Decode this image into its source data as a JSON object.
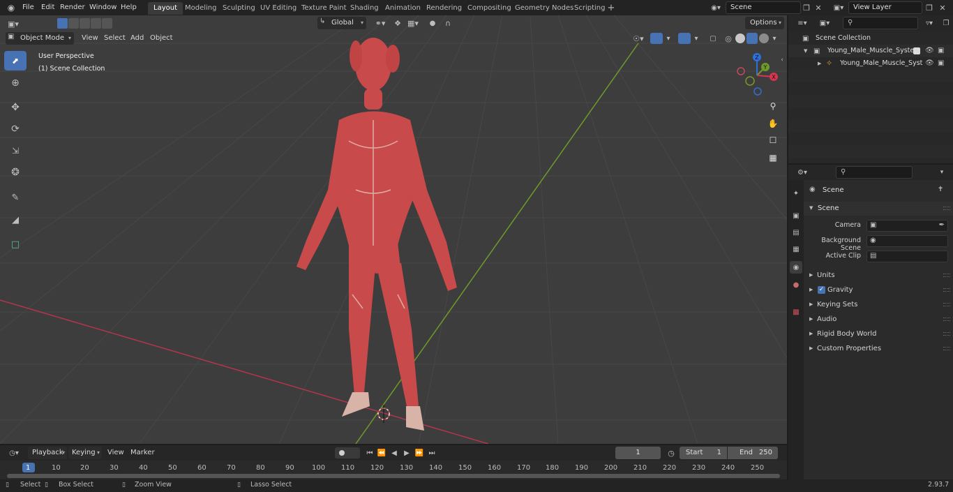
{
  "topbar": {
    "menus": [
      "File",
      "Edit",
      "Render",
      "Window",
      "Help"
    ],
    "workspaces": [
      "Layout",
      "Modeling",
      "Sculpting",
      "UV Editing",
      "Texture Paint",
      "Shading",
      "Animation",
      "Rendering",
      "Compositing",
      "Geometry Nodes",
      "Scripting"
    ],
    "active_workspace": "Layout",
    "scene_name": "Scene",
    "view_layer": "View Layer"
  },
  "viewport_header": {
    "mode": "Object Mode",
    "menus": [
      "View",
      "Select",
      "Add",
      "Object"
    ],
    "transform_orientation": "Global",
    "options_label": "Options"
  },
  "viewport": {
    "overlay_line1": "User Perspective",
    "overlay_line2": "(1) Scene Collection",
    "gizmo_axes": [
      "Z",
      "Y",
      "X"
    ],
    "colors": {
      "background": "#3d3d3d",
      "x_axis": "#b3364a",
      "y_axis": "#6e9a2a",
      "mesh": "#c84a4a"
    }
  },
  "outliner": {
    "root": "Scene Collection",
    "items": [
      "Young_Male_Muscle_System",
      "Young_Male_Muscle_Syst"
    ]
  },
  "properties": {
    "header": "Scene",
    "panel_title": "Scene",
    "fields": [
      {
        "label": "Camera"
      },
      {
        "label": "Background Scene"
      },
      {
        "label": "Active Clip"
      }
    ],
    "sections": [
      "Units",
      "Gravity",
      "Keying Sets",
      "Audio",
      "Rigid Body World",
      "Custom Properties"
    ],
    "gravity_checked": true
  },
  "timeline": {
    "menus": [
      "Playback",
      "Keying",
      "View",
      "Marker"
    ],
    "current_frame": "1",
    "start_label": "Start",
    "start_value": "1",
    "end_label": "End",
    "end_value": "250",
    "ruler": [
      "1",
      "10",
      "20",
      "30",
      "40",
      "50",
      "60",
      "70",
      "80",
      "90",
      "100",
      "110",
      "120",
      "130",
      "140",
      "150",
      "160",
      "170",
      "180",
      "190",
      "200",
      "210",
      "220",
      "230",
      "240",
      "250"
    ]
  },
  "statusbar": {
    "items": [
      "Select",
      "Box Select",
      "Zoom View",
      "Lasso Select"
    ],
    "version": "2.93.7"
  }
}
